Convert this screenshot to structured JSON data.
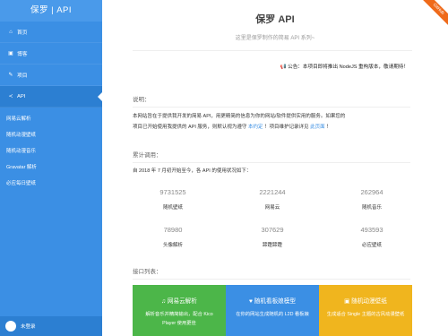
{
  "sidebar": {
    "brand": "保罗 | API",
    "items": [
      {
        "label": "首页",
        "icon": "home-icon",
        "glyph": "⌂"
      },
      {
        "label": "博客",
        "icon": "blog-icon",
        "glyph": "▣"
      },
      {
        "label": "项目",
        "icon": "wrench-icon",
        "glyph": "✎"
      },
      {
        "label": "API",
        "icon": "share-icon",
        "glyph": "≺"
      }
    ],
    "sub_items": [
      "网易云解析",
      "随机动漫壁纸",
      "随机动漫音乐",
      "Gravatar 解析",
      "必应每日壁纸"
    ],
    "user_label": "未登录"
  },
  "ribbon": "GitHub",
  "header": {
    "title": "保罗 API",
    "subtitle": "这里是保罗制作的简易 API 系列~"
  },
  "notice": "📢 公告：本项目即将推出 NodeJS 重构版本，敬请期待！",
  "intro": {
    "heading": "说明：",
    "line1": "本网站旨在于提供我开发的简易 API，用更精简的信息为你的网站/软件提供实用的服务。如果您的",
    "line2_before": "项目已开始使用我提供的 API 服务，则默认视为遵守",
    "line2_link": "本约定",
    "line2_mid": "！项目维护记录详见",
    "line2_link2": "此页面",
    "line2_end": "！"
  },
  "usage": {
    "heading": "累计调用：",
    "text": "自 2018 年 7 月初开始至今，各 API 的使用状况如下：",
    "stats": [
      {
        "value": "9731525",
        "label": "随机壁纸"
      },
      {
        "value": "2221244",
        "label": "网易云"
      },
      {
        "value": "262964",
        "label": "随机音乐"
      },
      {
        "value": "78980",
        "label": "头像解析"
      },
      {
        "value": "307629",
        "label": "蹄蹬蹄蹬"
      },
      {
        "value": "493593",
        "label": "必应壁纸"
      }
    ]
  },
  "api_list": {
    "heading": "接口列表：",
    "cards": [
      {
        "title": "网易云解析",
        "icon": "music-icon",
        "glyph": "♫",
        "desc": "解析音乐并精简输出，配合 Kico Player 使用更佳",
        "color": "#4cb649"
      },
      {
        "title": "随机看板娘模型",
        "icon": "heart-icon",
        "glyph": "♥",
        "desc": "在你的网站生成随机的 L2D 看板娘",
        "color": "#3b8fe4"
      },
      {
        "title": "随机动漫壁纸",
        "icon": "image-icon",
        "glyph": "▣",
        "desc": "生成适合 Single 主题的古风动漫壁纸",
        "color": "#f0b51e"
      }
    ]
  }
}
